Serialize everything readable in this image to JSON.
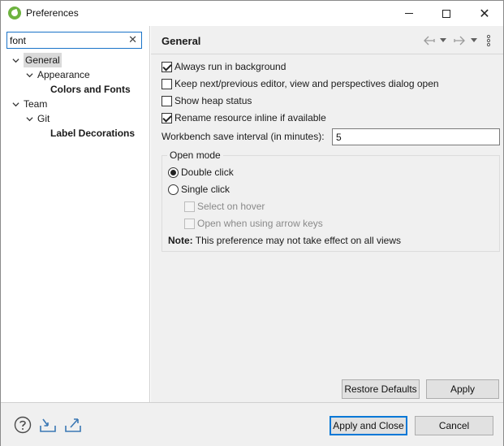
{
  "window": {
    "title": "Preferences",
    "icon": "spring-leaf-icon",
    "controls": [
      "minimize-icon",
      "maximize-icon",
      "close-icon"
    ]
  },
  "filter": {
    "value": "font",
    "clear_icon": "✕"
  },
  "tree": [
    {
      "label": "General",
      "level": 0,
      "expanded": true,
      "selected": true,
      "bold": false
    },
    {
      "label": "Appearance",
      "level": 1,
      "expanded": true,
      "selected": false,
      "bold": false
    },
    {
      "label": "Colors and Fonts",
      "level": 2,
      "expanded": null,
      "selected": false,
      "bold": true
    },
    {
      "label": "Team",
      "level": 0,
      "expanded": true,
      "selected": false,
      "bold": false
    },
    {
      "label": "Git",
      "level": 1,
      "expanded": true,
      "selected": false,
      "bold": false
    },
    {
      "label": "Label Decorations",
      "level": 2,
      "expanded": null,
      "selected": false,
      "bold": true
    }
  ],
  "page": {
    "title": "General",
    "nav_icons": [
      "back-arrow-icon",
      "dropdown-icon",
      "forward-arrow-icon",
      "dropdown-icon",
      "view-menu-icon"
    ]
  },
  "options": [
    {
      "label": "Always run in background",
      "checked": true
    },
    {
      "label": "Keep next/previous editor, view and perspectives dialog open",
      "checked": false
    },
    {
      "label": "Show heap status",
      "checked": false
    },
    {
      "label": "Rename resource inline if available",
      "checked": true
    }
  ],
  "save_interval": {
    "label": "Workbench save interval (in minutes):",
    "value": "5"
  },
  "open_mode": {
    "title": "Open mode",
    "radios": [
      {
        "label": "Double click",
        "selected": true
      },
      {
        "label": "Single click",
        "selected": false
      }
    ],
    "sub_options": [
      {
        "label": "Select on hover",
        "checked": false,
        "enabled": false
      },
      {
        "label": "Open when using arrow keys",
        "checked": false,
        "enabled": false
      }
    ],
    "note_bold": "Note:",
    "note_text": " This preference may not take effect on all views"
  },
  "buttons": {
    "restore_defaults": "Restore Defaults",
    "apply": "Apply",
    "apply_and_close": "Apply and Close",
    "cancel": "Cancel"
  },
  "bottom_icons": [
    "help-icon",
    "import-icon",
    "export-icon"
  ],
  "colors": {
    "accent": "#0078d7",
    "spring_green": "#6db33f",
    "panel_bg": "#f0f0f0"
  }
}
